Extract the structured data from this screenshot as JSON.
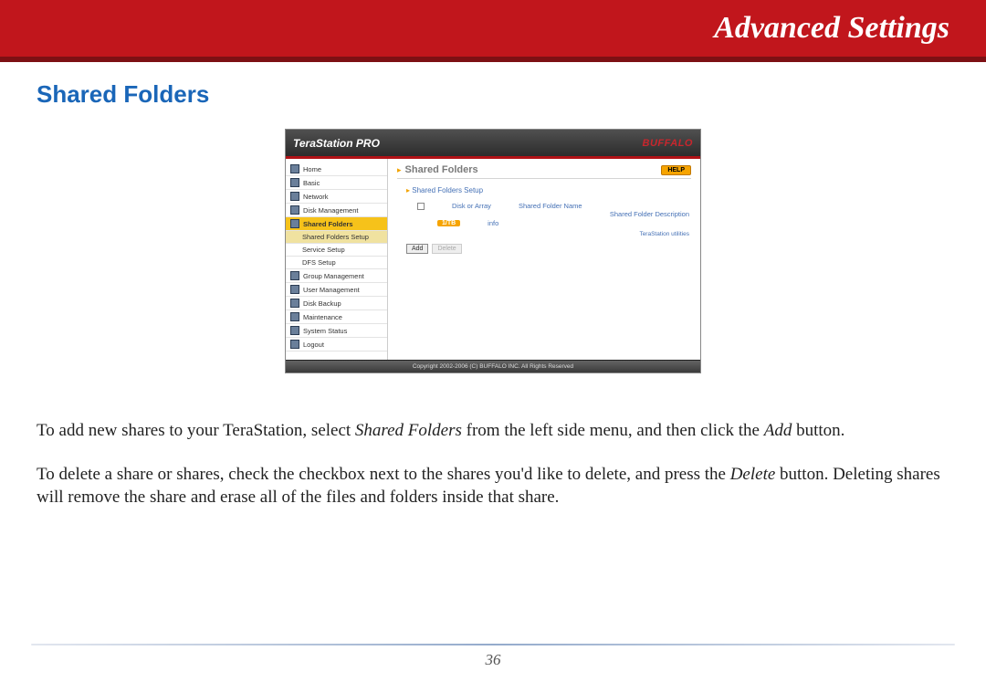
{
  "banner": {
    "title": "Advanced Settings"
  },
  "section": {
    "title": "Shared Folders"
  },
  "screenshot": {
    "header": {
      "product": "TeraStation PRO",
      "brand": "BUFFALO"
    },
    "sidebar": {
      "items": [
        "Home",
        "Basic",
        "Network",
        "Disk Management",
        "Shared Folders",
        "Shared Folders Setup",
        "Service Setup",
        "DFS Setup",
        "Group Management",
        "User Management",
        "Disk Backup",
        "Maintenance",
        "System Status",
        "Logout"
      ]
    },
    "main": {
      "title": "Shared Folders",
      "help": "HELP",
      "subtitle": "Shared Folders Setup",
      "col1": "Disk or Array",
      "col2": "Shared Folder Name",
      "col3": "Shared Folder Description",
      "row_disk": "1/TB",
      "row_name": "info",
      "row_desc": "TeraStation utilities",
      "add_btn": "Add",
      "del_btn": "Delete"
    },
    "footer": "Copyright 2002-2006 (C) BUFFALO INC. All Rights Reserved"
  },
  "paragraphs": {
    "p1a": "To add new shares to your TeraStation, select ",
    "p1b": "Shared Folders",
    "p1c": " from the left side menu, and then click the ",
    "p1d": "Add",
    "p1e": " button.",
    "p2a": "To delete a share or shares, check the checkbox next to the shares you'd like to delete, and press the ",
    "p2b": "Delete",
    "p2c": " button.  Deleting shares will remove the share and erase all of the files and folders inside that share."
  },
  "page_number": "36"
}
